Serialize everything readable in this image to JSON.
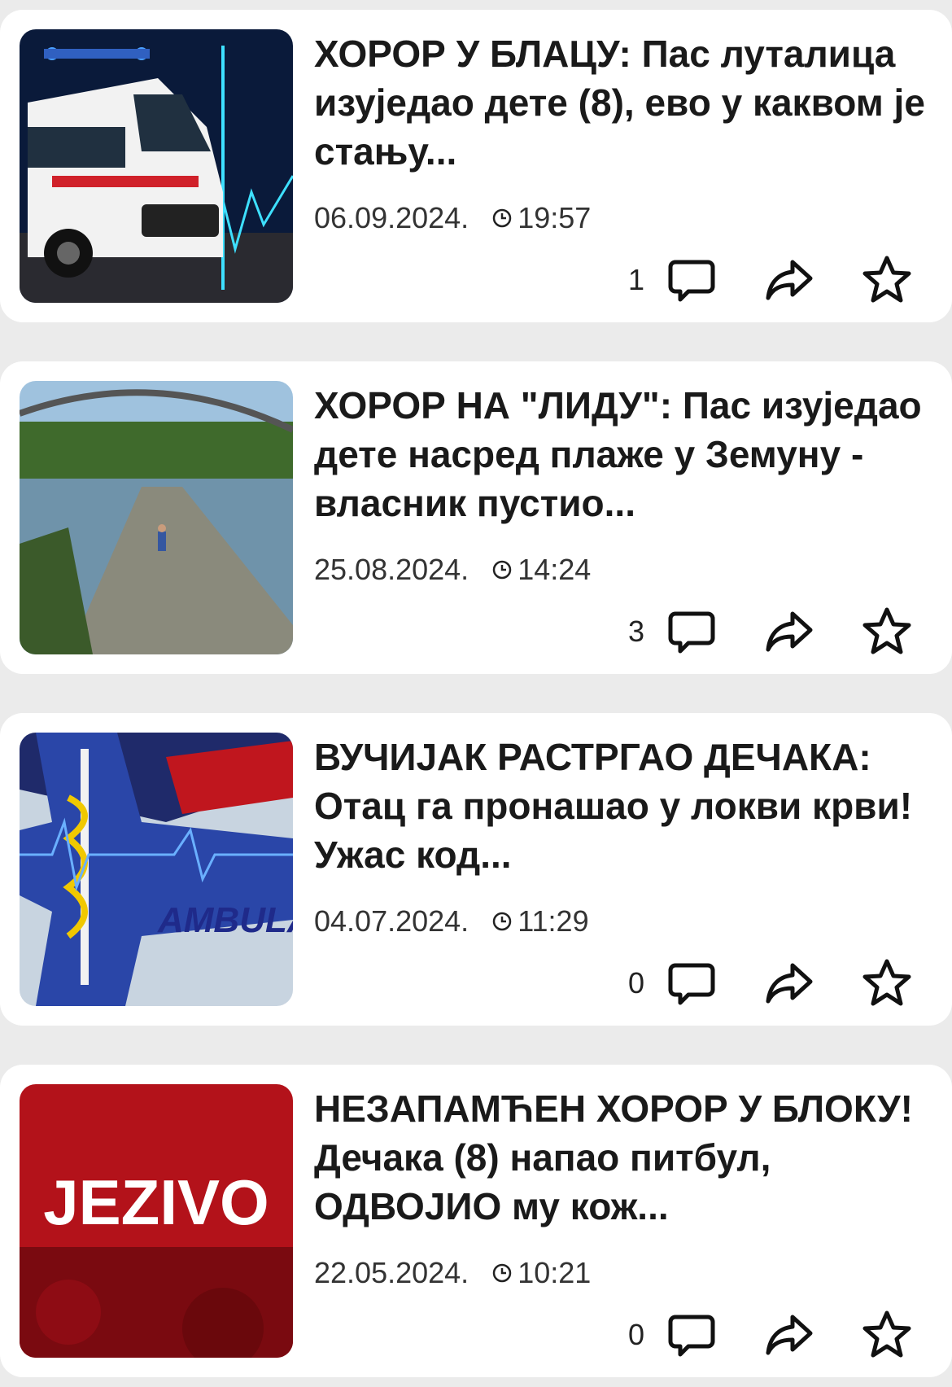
{
  "articles": [
    {
      "title": "ХОРОР У БЛАЦУ: Пас луталица изујeдао дете (8), ево у каквом је стању...",
      "date": "06.09.2024.",
      "time": "19:57",
      "comments": "1",
      "image_label": ""
    },
    {
      "title": "ХОРОР НА \"ЛИДУ\": Пас изујeдао дете насред плаже у Земуну - власник пустио...",
      "date": "25.08.2024.",
      "time": "14:24",
      "comments": "3",
      "image_label": ""
    },
    {
      "title": "ВУЧИЈАК РАСТРГАО ДЕЧАКА: Отац га пронашао у локви крви! Ужас код...",
      "date": "04.07.2024.",
      "time": "11:29",
      "comments": "0",
      "image_label": "AMBULAN"
    },
    {
      "title": "НЕЗАПАМЋЕН ХОРОР У БЛОКУ! Дечака (8) напао питбул, ОДВОЈИО му кож...",
      "date": "22.05.2024.",
      "time": "10:21",
      "comments": "0",
      "image_label": "JEZIVO"
    }
  ],
  "icons": {
    "clock": "clock-icon",
    "comment": "comment-icon",
    "share": "share-icon",
    "bookmark": "star-icon"
  }
}
